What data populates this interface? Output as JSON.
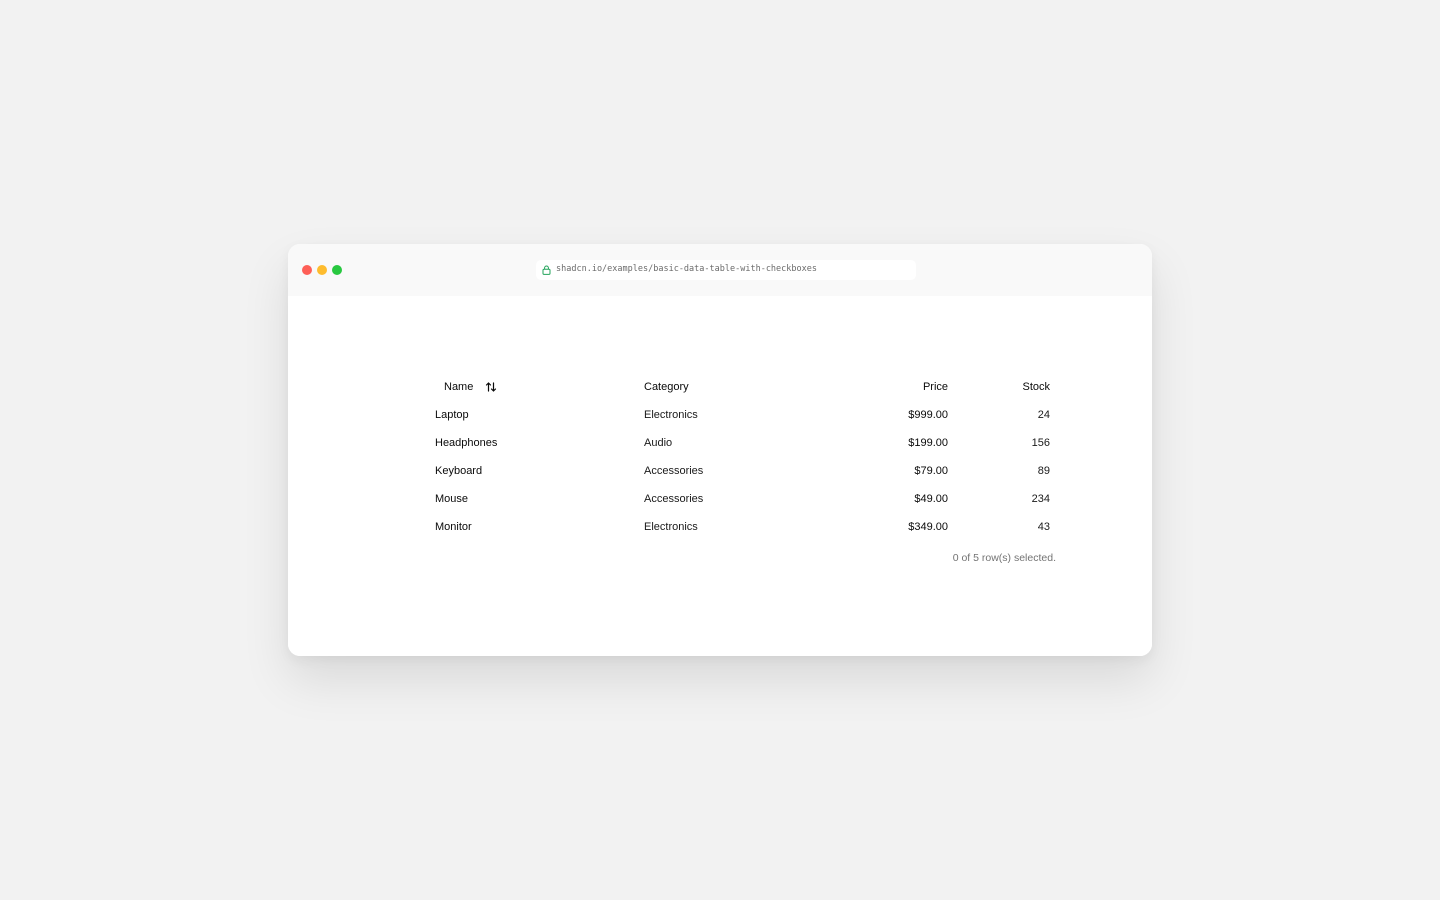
{
  "browser": {
    "url": "shadcn.io/examples/basic-data-table-with-checkboxes",
    "lock_icon": "lock-icon",
    "accent_secure": "#22a35a",
    "traffic_lights": {
      "close": "#fe5f57",
      "minimize": "#febc2e",
      "maximize": "#28c840"
    }
  },
  "table": {
    "columns": {
      "name": "Name",
      "category": "Category",
      "price": "Price",
      "stock": "Stock"
    },
    "sort_icon": "arrow-up-down-icon",
    "rows": [
      {
        "name": "Laptop",
        "category": "Electronics",
        "price": "$999.00",
        "stock": "24"
      },
      {
        "name": "Headphones",
        "category": "Audio",
        "price": "$199.00",
        "stock": "156"
      },
      {
        "name": "Keyboard",
        "category": "Accessories",
        "price": "$79.00",
        "stock": "89"
      },
      {
        "name": "Mouse",
        "category": "Accessories",
        "price": "$49.00",
        "stock": "234"
      },
      {
        "name": "Monitor",
        "category": "Electronics",
        "price": "$349.00",
        "stock": "43"
      }
    ],
    "selection_status": "0 of 5 row(s) selected."
  }
}
